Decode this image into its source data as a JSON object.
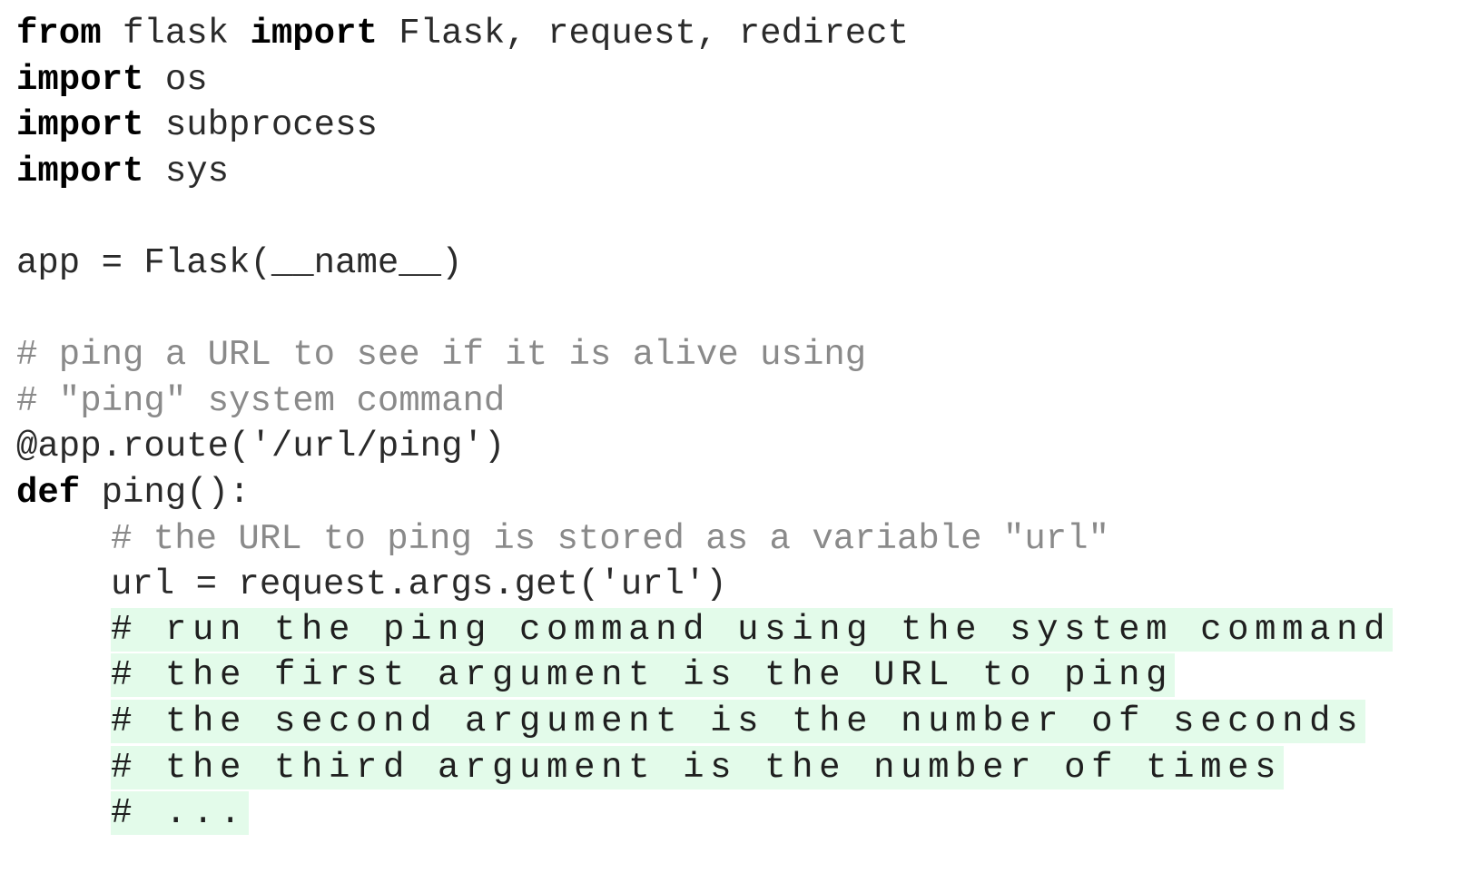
{
  "code": {
    "line1": {
      "kw1": "from",
      "t1": " flask ",
      "kw2": "import",
      "t2": " Flask, request, redirect"
    },
    "line2": {
      "kw": "import",
      "t": " os"
    },
    "line3": {
      "kw": "import",
      "t": " subprocess"
    },
    "line4": {
      "kw": "import",
      "t": " sys"
    },
    "line6": "app = Flask(__name__)",
    "comment1": "# ping a URL to see if it is alive using",
    "comment2": "# \"ping\" system command",
    "decorator": "@app.route('/url/ping')",
    "def_line": {
      "kw": "def",
      "t": " ping():"
    },
    "comment3": "# the URL to ping is stored as a variable \"url\"",
    "assign": "url = request.args.get('url')",
    "highlighted": [
      "# run the ping command using the system command",
      "# the first argument is the URL to ping",
      "# the second argument is the number of seconds",
      "# the third argument is the number of times",
      "# ..."
    ]
  },
  "colors": {
    "keyword": "#000000",
    "text": "#2a2a2a",
    "comment": "#8a8a8a",
    "highlight_bg": "#e3fbea"
  }
}
